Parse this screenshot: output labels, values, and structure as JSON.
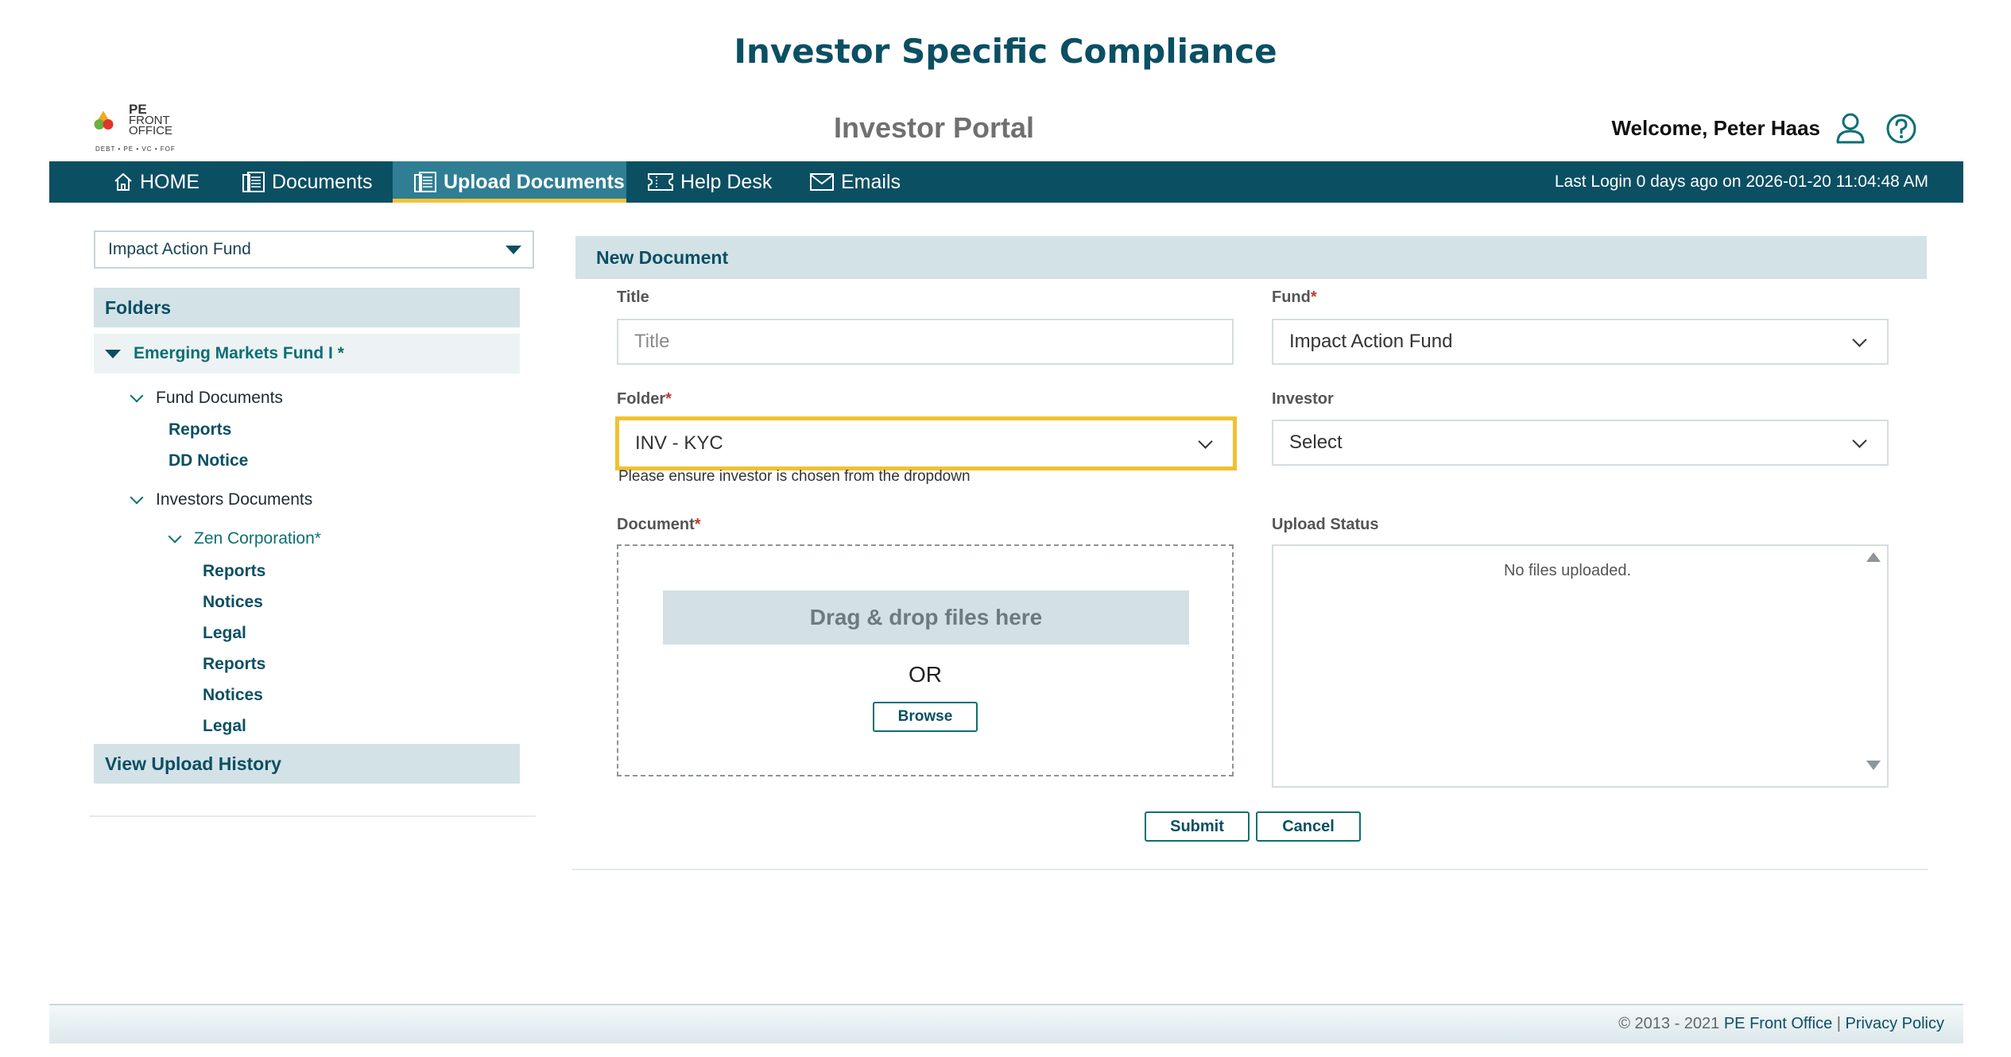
{
  "page": {
    "heading": "Investor Specific Compliance"
  },
  "brand": {
    "logo_line1": "PE",
    "logo_line2": "FRONT",
    "logo_line3": "OFFICE",
    "logo_tagline": "DEBT • PE • VC • FOF"
  },
  "header": {
    "portal_title": "Investor Portal",
    "welcome": "Welcome, Peter Haas"
  },
  "nav": {
    "items": [
      {
        "label": "HOME",
        "icon": "home-icon"
      },
      {
        "label": "Documents",
        "icon": "documents-icon"
      },
      {
        "label": "Upload Documents",
        "icon": "upload-documents-icon"
      },
      {
        "label": "Help Desk",
        "icon": "ticket-icon"
      },
      {
        "label": "Emails",
        "icon": "mail-icon"
      }
    ],
    "active": "Upload Documents",
    "last_login": "Last Login 0 days ago on 2026-01-20 11:04:48 AM"
  },
  "sidebar": {
    "fund_selected": "Impact Action Fund",
    "folders_title": "Folders",
    "root": "Emerging Markets Fund I *",
    "fund_documents": "Fund Documents",
    "fund_children": [
      "Reports",
      "DD Notice"
    ],
    "investors_documents": "Investors Documents",
    "investor": "Zen Corporation*",
    "investor_children": [
      "Reports",
      "Notices",
      "Legal",
      "Reports",
      "Notices",
      "Legal"
    ],
    "view_history": "View Upload History"
  },
  "form": {
    "panel_title": "New Document",
    "title_label": "Title",
    "title_placeholder": "Title",
    "fund_label": "Fund",
    "fund_value": "Impact Action Fund",
    "folder_label": "Folder",
    "folder_value": "INV - KYC",
    "folder_hint": "Please ensure investor is chosen from the dropdown",
    "investor_label": "Investor",
    "investor_value": "Select",
    "document_label": "Document",
    "drag_text": "Drag & drop files here",
    "or_text": "OR",
    "browse_label": "Browse",
    "upload_status_label": "Upload Status",
    "no_files": "No files uploaded.",
    "submit_label": "Submit",
    "cancel_label": "Cancel",
    "required_mark": "*"
  },
  "footer": {
    "copyright": "© 2013 - 2021 ",
    "company": "PE Front Office",
    "sep": " | ",
    "privacy": "Privacy Policy"
  },
  "colors": {
    "primary": "#0b4f63",
    "active_tab": "#2f7e94",
    "highlight": "#f0c230",
    "panel": "#d3e2e6"
  }
}
